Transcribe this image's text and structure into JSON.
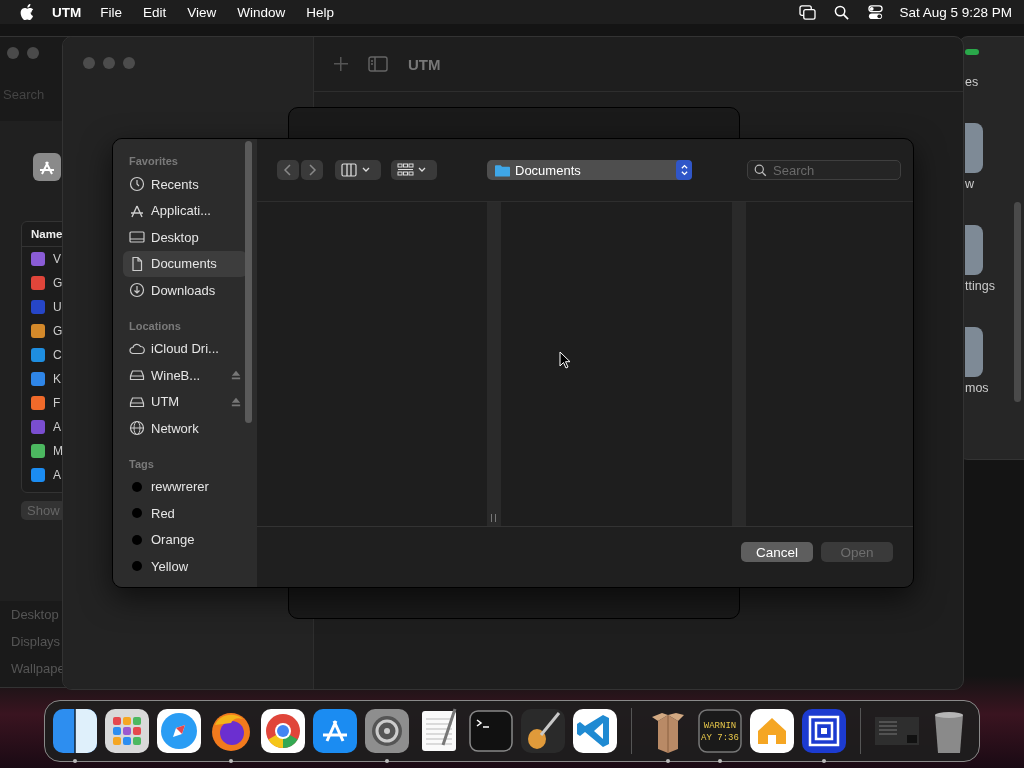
{
  "menu_bar": {
    "app": "UTM",
    "menus": [
      "File",
      "Edit",
      "View",
      "Window",
      "Help"
    ],
    "clock": "Sat Aug 5  9:28 PM"
  },
  "settings_window": {
    "search_placeholder": "Search",
    "list_heading": "Name",
    "rows": [
      {
        "label": "V",
        "color": "#8a5cd6"
      },
      {
        "label": "G",
        "color": "#e0453a"
      },
      {
        "label": "U",
        "color": "#2646c8"
      },
      {
        "label": "G",
        "color": "#d4892a"
      },
      {
        "label": "C",
        "color": "#1e8ee0"
      },
      {
        "label": "K",
        "color": "#2f86e8"
      },
      {
        "label": "F",
        "color": "#f06a2a"
      },
      {
        "label": "A",
        "color": "#7a4ed0"
      },
      {
        "label": "M",
        "color": "#4cb860"
      },
      {
        "label": "A",
        "color": "#1b8cf2"
      }
    ],
    "show_button": "Show",
    "sidebar_items": [
      "Desktop",
      "Displays",
      "Wallpape"
    ]
  },
  "right_window": {
    "labels": [
      "es",
      "w",
      "ttings",
      "mos"
    ]
  },
  "utm_window": {
    "title": "UTM"
  },
  "dialog": {
    "location": "Documents",
    "search_placeholder": "Search",
    "sections": [
      {
        "heading": "Favorites",
        "items": [
          {
            "label": "Recents",
            "kind": "clock",
            "selected": false,
            "eject": false
          },
          {
            "label": "Applicati...",
            "kind": "apps",
            "selected": false,
            "eject": false
          },
          {
            "label": "Desktop",
            "kind": "desktop",
            "selected": false,
            "eject": false
          },
          {
            "label": "Documents",
            "kind": "doc",
            "selected": true,
            "eject": false
          },
          {
            "label": "Downloads",
            "kind": "download",
            "selected": false,
            "eject": false
          }
        ]
      },
      {
        "heading": "Locations",
        "items": [
          {
            "label": "iCloud Dri...",
            "kind": "cloud",
            "selected": false,
            "eject": false
          },
          {
            "label": "WineB...",
            "kind": "drive",
            "selected": false,
            "eject": true
          },
          {
            "label": "UTM",
            "kind": "drive",
            "selected": false,
            "eject": true
          },
          {
            "label": "Network",
            "kind": "globe",
            "selected": false,
            "eject": false
          }
        ]
      },
      {
        "heading": "Tags",
        "items": [
          {
            "label": "rewwrerer",
            "kind": "tag",
            "selected": false,
            "eject": false
          },
          {
            "label": "Red",
            "kind": "tag",
            "selected": false,
            "eject": false
          },
          {
            "label": "Orange",
            "kind": "tag",
            "selected": false,
            "eject": false
          },
          {
            "label": "Yellow",
            "kind": "tag",
            "selected": false,
            "eject": false
          }
        ]
      }
    ],
    "buttons": [
      {
        "label": "Cancel",
        "disabled": false
      },
      {
        "label": "Open",
        "disabled": true
      }
    ]
  },
  "dock": [
    {
      "kind": "finder",
      "running": true
    },
    {
      "kind": "launchpad",
      "running": false
    },
    {
      "kind": "safari",
      "running": false
    },
    {
      "kind": "firefox",
      "running": true
    },
    {
      "kind": "chrome",
      "running": false
    },
    {
      "kind": "appstore",
      "running": false
    },
    {
      "kind": "settings",
      "running": true
    },
    {
      "kind": "textedit",
      "running": false
    },
    {
      "kind": "terminal",
      "running": false
    },
    {
      "kind": "guitar",
      "running": false
    },
    {
      "kind": "vscode",
      "running": false
    },
    {
      "kind": "divider"
    },
    {
      "kind": "box",
      "running": true
    },
    {
      "kind": "console",
      "running": true,
      "lines": [
        "WARNIN",
        "AY 7:36"
      ]
    },
    {
      "kind": "home",
      "running": false
    },
    {
      "kind": "utm",
      "running": true
    },
    {
      "kind": "divider"
    },
    {
      "kind": "thumbnail",
      "running": false
    },
    {
      "kind": "trash",
      "running": false
    }
  ]
}
